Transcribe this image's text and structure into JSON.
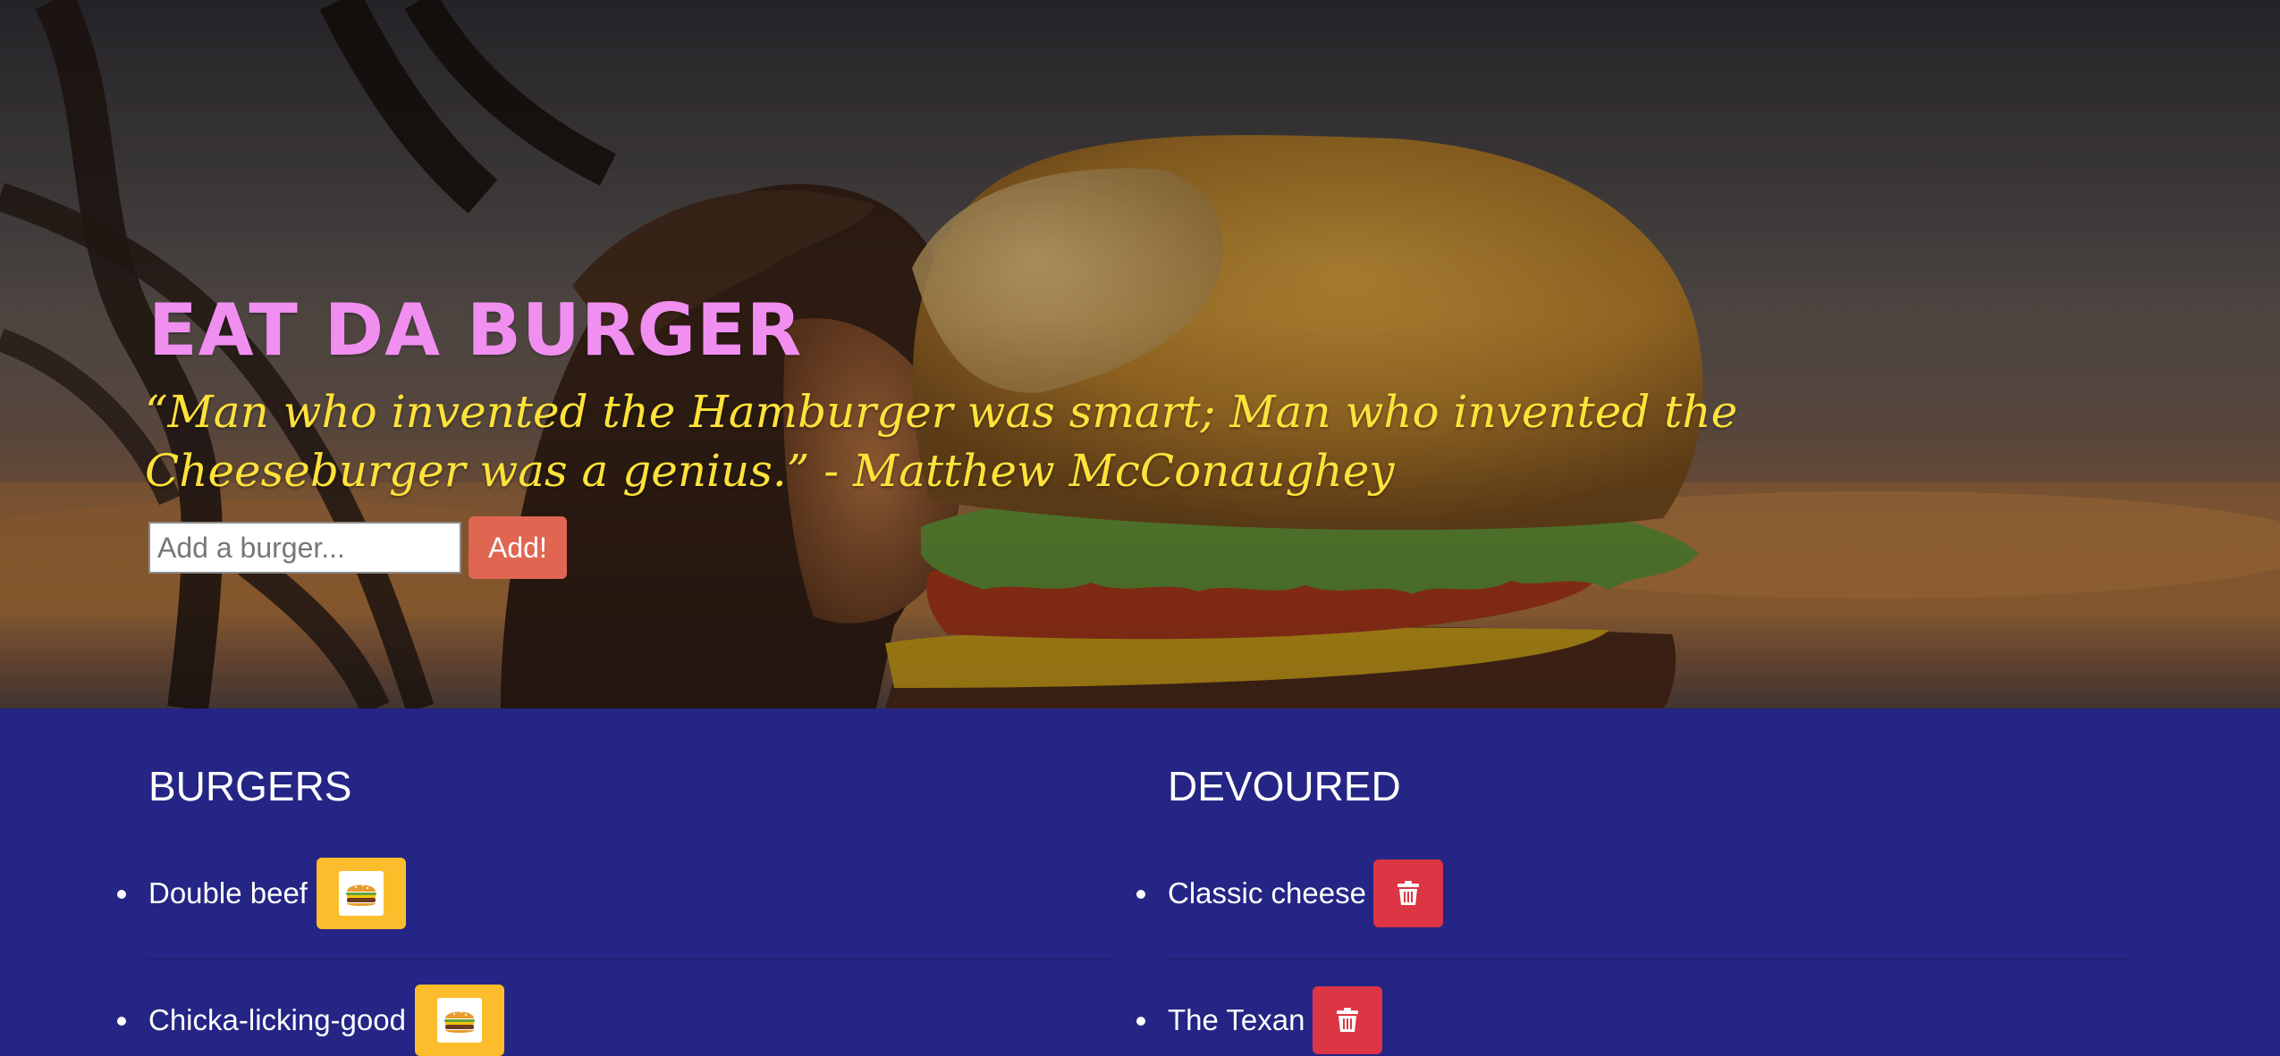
{
  "hero": {
    "title": "EAT DA BURGER",
    "quote": "“Man who invented the Hamburger was smart; Man who invented the Cheeseburger was a genius.” - Matthew McConaughey",
    "input_placeholder": "Add a burger...",
    "add_label": "Add!",
    "colors": {
      "title": "#f08ff0",
      "quote": "#ffe23a",
      "add_button": "#e06652"
    }
  },
  "burgers": {
    "title": "BURGERS",
    "items": [
      {
        "name": "Double beef",
        "action_icon": "burger-icon"
      },
      {
        "name": "Chicka-licking-good",
        "action_icon": "burger-icon"
      }
    ],
    "colors": {
      "action_button": "#fbbd2c"
    }
  },
  "devoured": {
    "title": "DEVOURED",
    "items": [
      {
        "name": "Classic cheese",
        "action_icon": "trash-icon"
      },
      {
        "name": "The Texan",
        "action_icon": "trash-icon"
      }
    ],
    "colors": {
      "action_button": "#dc3543"
    }
  },
  "page": {
    "background": "#242584"
  }
}
